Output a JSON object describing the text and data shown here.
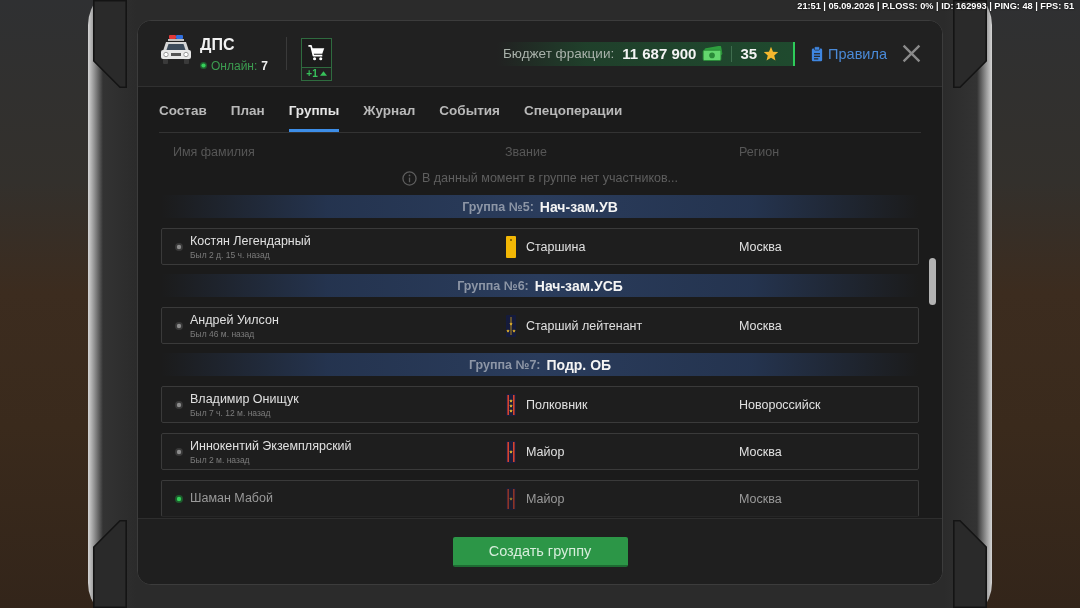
{
  "status_bar": {
    "text": "21:51 | 05.09.2026 | P.LOSS: 0% | ID: 162993 | PING: 48 | FPS: 51"
  },
  "header": {
    "title": "ДПС",
    "online_label": "Онлайн:",
    "online_count": "7",
    "cart_badge": "+1",
    "budget_label": "Бюджет фракции:",
    "budget_value": "11 687 900",
    "points": "35",
    "rules_link": "Правила"
  },
  "tabs": [
    {
      "label": "Состав",
      "selected": false
    },
    {
      "label": "План",
      "selected": false
    },
    {
      "label": "Группы",
      "selected": true
    },
    {
      "label": "Журнал",
      "selected": false
    },
    {
      "label": "События",
      "selected": false
    },
    {
      "label": "Спецоперации",
      "selected": false
    }
  ],
  "columns": [
    "Имя фамилия",
    "Звание",
    "Регион"
  ],
  "groups": [
    {
      "empty_message": "В данный момент в группе нет участников..."
    },
    {
      "label": "Группа №5:",
      "name": "Нач-зам.УВ",
      "members": [
        {
          "name": "Костян Легендарный",
          "last_seen": "Был 2 д. 15 ч. назад",
          "online": false,
          "rank": {
            "title": "Старшина",
            "kind": "sergeant"
          },
          "region": "Москва"
        }
      ]
    },
    {
      "label": "Группа №6:",
      "name": "Нач-зам.УСБ",
      "members": [
        {
          "name": "Андрей Уилсон",
          "last_seen": "Был 46 м. назад",
          "online": false,
          "rank": {
            "title": "Старший лейтенант",
            "kind": "lieutenant"
          },
          "region": "Москва"
        }
      ]
    },
    {
      "label": "Группа №7:",
      "name": "Подр. ОБ",
      "members": [
        {
          "name": "Владимир Онищук",
          "last_seen": "Был 7 ч. 12 м. назад",
          "online": false,
          "rank": {
            "title": "Полковник",
            "kind": "colonel"
          },
          "region": "Новороссийск"
        },
        {
          "name": "Иннокентий Экземплярский",
          "last_seen": "Был 2 м. назад",
          "online": false,
          "rank": {
            "title": "Майор",
            "kind": "major"
          },
          "region": "Москва"
        },
        {
          "name": "Шаман Мабой",
          "online": true,
          "rank": {
            "title": "Майор",
            "kind": "major"
          },
          "region": "Москва"
        }
      ]
    }
  ],
  "create_button": "Создать группу"
}
